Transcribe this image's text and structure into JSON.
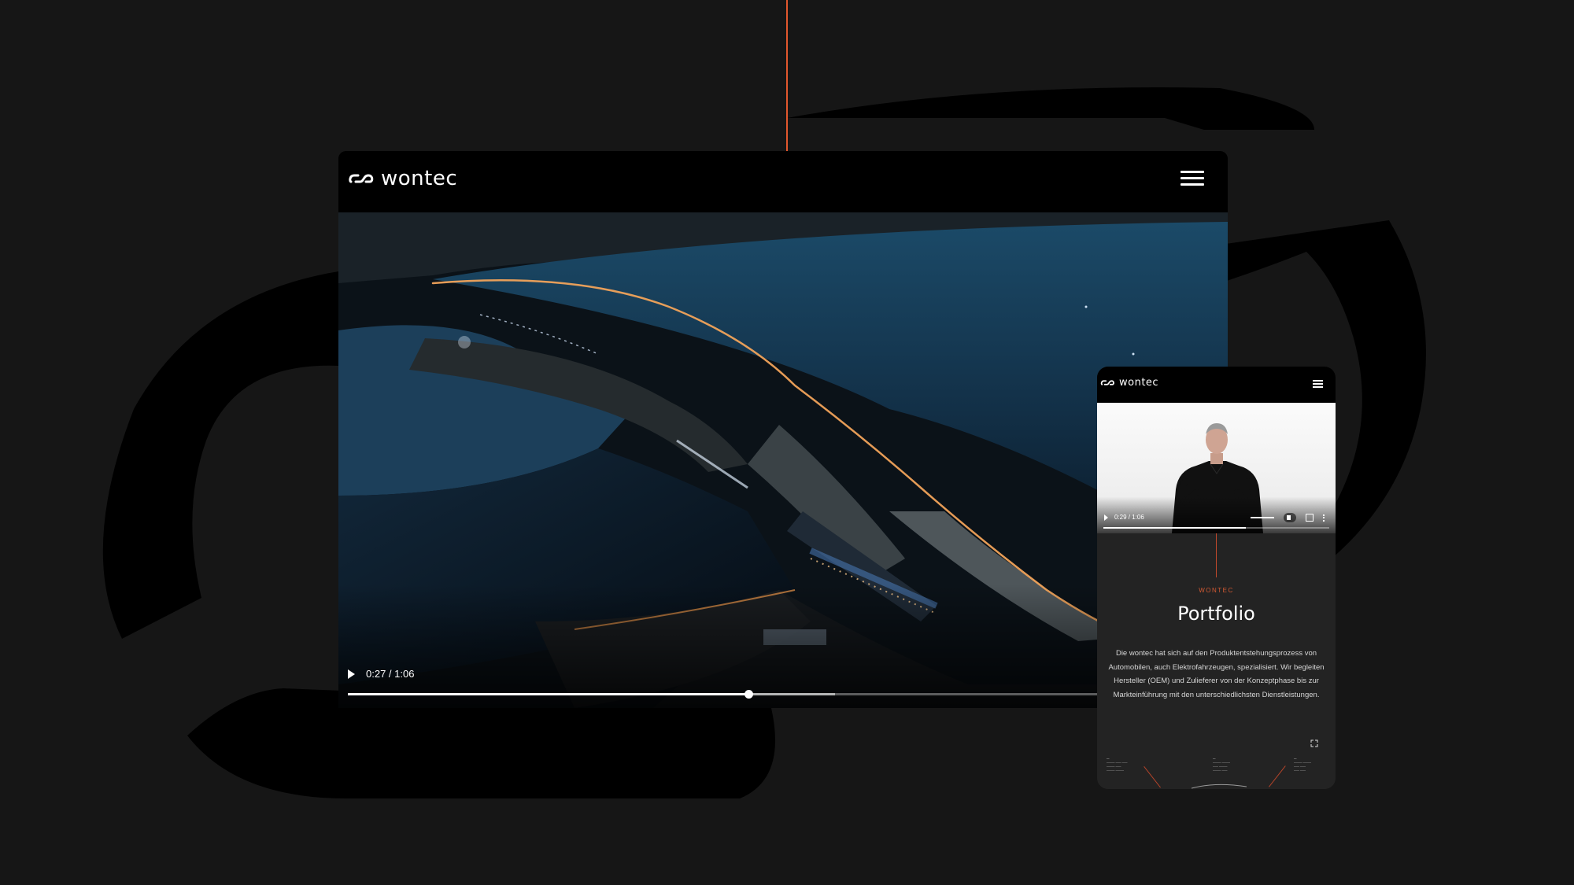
{
  "desktop": {
    "brand": "wontec",
    "video": {
      "time": "0:27 / 1:06",
      "progress": 0.46,
      "buffered": 0.56
    }
  },
  "mobile": {
    "brand": "wontec",
    "video": {
      "time": "0:29 / 1:06",
      "progress": 0.63
    },
    "eyebrow": "WONTEC",
    "title": "Portfolio",
    "text": "Die wontec hat sich auf den Produktentstehungsprozess von Automobilen, auch Elektrofahrzeugen, spezialisiert. Wir begleiten Hersteller (OEM) und Zulieferer von der Konzeptphase bis zur Markteinführung mit den unterschiedlichsten Dienstleistungen."
  },
  "colors": {
    "accent": "#e2572d",
    "background": "#161616"
  },
  "icons": [
    "play-icon",
    "menu-icon",
    "mute-icon",
    "fullscreen-icon",
    "more-icon",
    "expand-icon"
  ]
}
